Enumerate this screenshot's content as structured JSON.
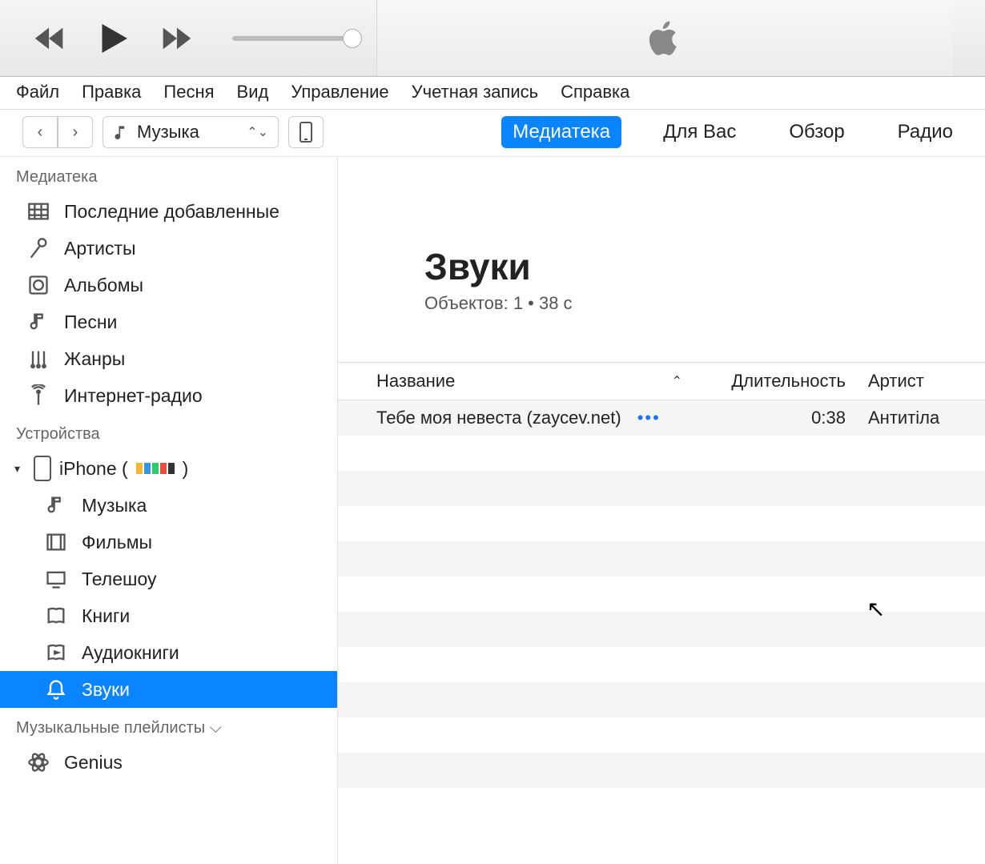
{
  "menubar": [
    "Файл",
    "Правка",
    "Песня",
    "Вид",
    "Управление",
    "Учетная запись",
    "Справка"
  ],
  "media_selector": {
    "label": "Музыка"
  },
  "tabs": [
    {
      "label": "Медиатека",
      "active": true
    },
    {
      "label": "Для Вас",
      "active": false
    },
    {
      "label": "Обзор",
      "active": false
    },
    {
      "label": "Радио",
      "active": false
    }
  ],
  "sidebar": {
    "section_library": "Медиатека",
    "library_items": [
      {
        "key": "recent",
        "label": "Последние добавленные"
      },
      {
        "key": "artists",
        "label": "Артисты"
      },
      {
        "key": "albums",
        "label": "Альбомы"
      },
      {
        "key": "songs",
        "label": "Песни"
      },
      {
        "key": "genres",
        "label": "Жанры"
      },
      {
        "key": "radio",
        "label": "Интернет-радио"
      }
    ],
    "section_devices": "Устройства",
    "device": {
      "name_prefix": "iPhone (",
      "name_suffix": ")"
    },
    "device_children": [
      {
        "key": "music",
        "label": "Музыка"
      },
      {
        "key": "movies",
        "label": "Фильмы"
      },
      {
        "key": "tv",
        "label": "Телешоу"
      },
      {
        "key": "books",
        "label": "Книги"
      },
      {
        "key": "audiobooks",
        "label": "Аудиокниги"
      },
      {
        "key": "tones",
        "label": "Звуки",
        "selected": true
      }
    ],
    "section_playlists": "Музыкальные плейлисты",
    "playlists": [
      {
        "key": "genius",
        "label": "Genius"
      }
    ]
  },
  "content": {
    "title": "Звуки",
    "subtitle": "Объектов: 1 • 38 с",
    "columns": {
      "title": "Название",
      "duration": "Длительность",
      "artist": "Артист"
    },
    "rows": [
      {
        "title": "Тебе моя невеста (zaycev.net)",
        "duration": "0:38",
        "artist": "Антитіла"
      }
    ]
  }
}
